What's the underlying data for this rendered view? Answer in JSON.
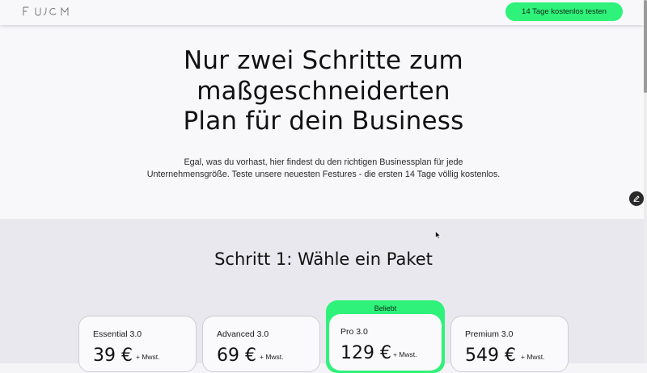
{
  "header": {
    "logo_text": "FUJCM",
    "cta_label": "14 Tage kostenlos testen"
  },
  "hero": {
    "title_lines": [
      "Nur zwei Schritte zum",
      "maßgeschneiderten",
      "Plan für dein Business"
    ],
    "subtitle_lines": [
      "Egal, was du vorhast, hier findest du den richtigen Businessplan für jede",
      "Unternehmensgröße. Teste unsere neuesten Festures - die ersten 14 Tage völlig kostenlos."
    ]
  },
  "step1": {
    "title": "Schritt 1: Wähle ein Paket",
    "popular_label": "Beliebt",
    "plans": [
      {
        "name": "Essential 3.0",
        "price": "39 €",
        "tax": "+ Mwst."
      },
      {
        "name": "Advanced 3.0",
        "price": "69 €",
        "tax": "+ Mwst."
      },
      {
        "name": "Pro 3.0",
        "price": "129 €",
        "tax": "+ Mwst."
      },
      {
        "name": "Premium 3.0",
        "price": "549 €",
        "tax": "+ Mwst."
      }
    ]
  },
  "icons": {
    "edit": "pencil-icon",
    "cursor": "mouse-cursor-icon"
  },
  "colors": {
    "accent": "#2ff27a",
    "hero_bg": "#f8f7fa",
    "section_bg": "#e9e8ee",
    "card_border": "#cfcdd6"
  }
}
